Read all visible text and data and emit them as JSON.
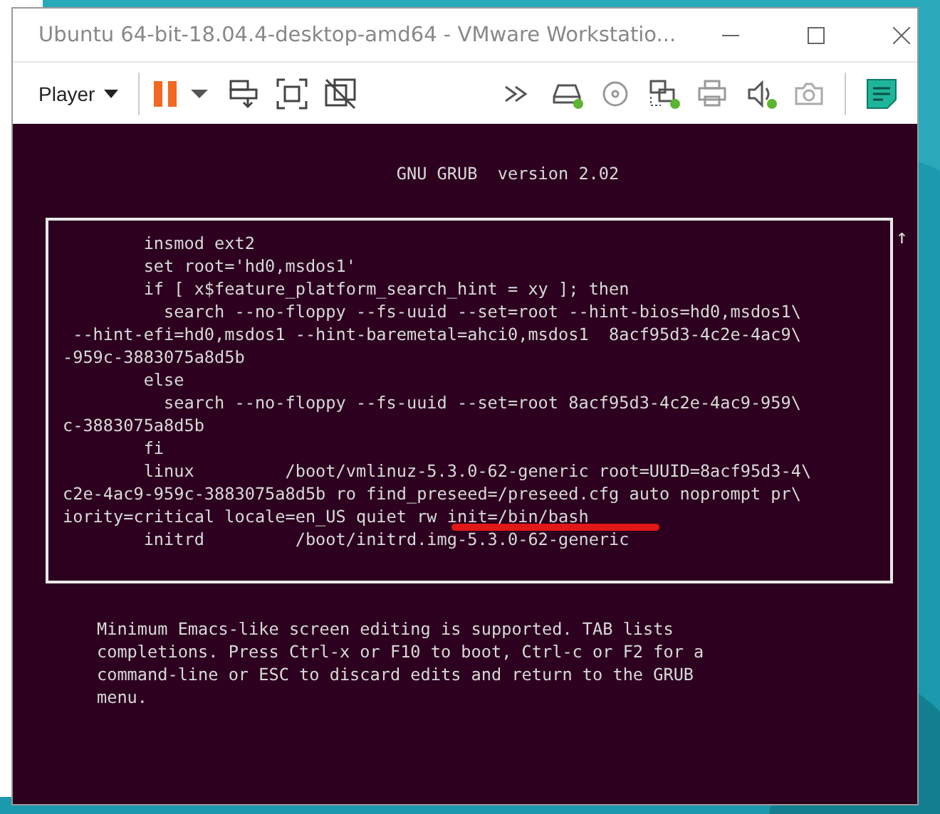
{
  "window": {
    "title": "Ubuntu 64-bit-18.04.4-desktop-amd64 - VMware Workstatio..."
  },
  "toolbar": {
    "menu": "Player",
    "devices": [
      {
        "kind": "disk",
        "connected": true
      },
      {
        "kind": "cd",
        "connected": false
      },
      {
        "kind": "network",
        "connected": true
      },
      {
        "kind": "printer",
        "connected": false
      },
      {
        "kind": "sound",
        "connected": true
      },
      {
        "kind": "camera",
        "connected": false
      }
    ]
  },
  "grub": {
    "title": "GNU GRUB  version 2.02",
    "scroll_indicator": "↑",
    "lines": [
      "        insmod ext2",
      "        set root='hd0,msdos1'",
      "        if [ x$feature_platform_search_hint = xy ]; then",
      "          search --no-floppy --fs-uuid --set=root --hint-bios=hd0,msdos1\\",
      " --hint-efi=hd0,msdos1 --hint-baremetal=ahci0,msdos1  8acf95d3-4c2e-4ac9\\",
      "-959c-3883075a8d5b",
      "        else",
      "          search --no-floppy --fs-uuid --set=root 8acf95d3-4c2e-4ac9-959\\",
      "c-3883075a8d5b",
      "        fi",
      "        linux         /boot/vmlinuz-5.3.0-62-generic root=UUID=8acf95d3-4\\",
      "c2e-4ac9-959c-3883075a8d5b ro find_preseed=/preseed.cfg auto noprompt pr\\",
      "iority=critical locale=en_US quiet rw init=/bin/bash",
      "        initrd         /boot/initrd.img-5.3.0-62-generic"
    ],
    "help": [
      "Minimum Emacs-like screen editing is supported. TAB lists",
      "completions. Press Ctrl-x or F10 to boot, Ctrl-c or F2 for a",
      "command-line or ESC to discard edits and return to the GRUB",
      "menu."
    ]
  }
}
